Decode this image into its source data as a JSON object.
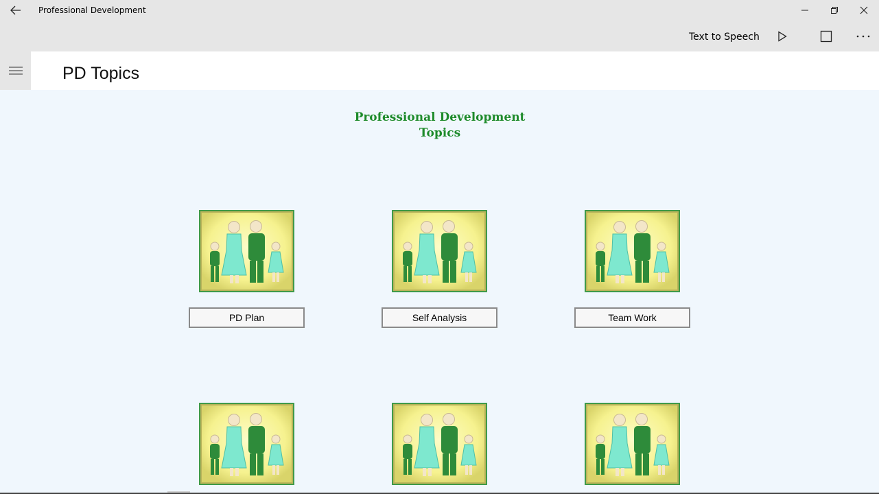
{
  "window": {
    "title": "Professional Development"
  },
  "commandbar": {
    "tts_label": "Text to Speech"
  },
  "header": {
    "page_title": "PD Topics"
  },
  "main": {
    "heading_line1": "Professional Development",
    "heading_line2": "Topics",
    "topics": [
      {
        "label": "PD Plan"
      },
      {
        "label": "Self Analysis"
      },
      {
        "label": "Team Work"
      }
    ]
  },
  "icons": {
    "back": "back-arrow-icon",
    "minimize": "minimize-icon",
    "maximize": "restore-icon",
    "close": "close-icon",
    "play": "play-icon",
    "stop": "stop-icon",
    "more": "more-icon",
    "menu": "hamburger-icon",
    "tile": "family-icon"
  },
  "colors": {
    "accent_green": "#1e8b2b",
    "tile_yellow": "#f8f59c",
    "figure_green": "#2e8b3a",
    "figure_cyan": "#7ee8cf"
  }
}
